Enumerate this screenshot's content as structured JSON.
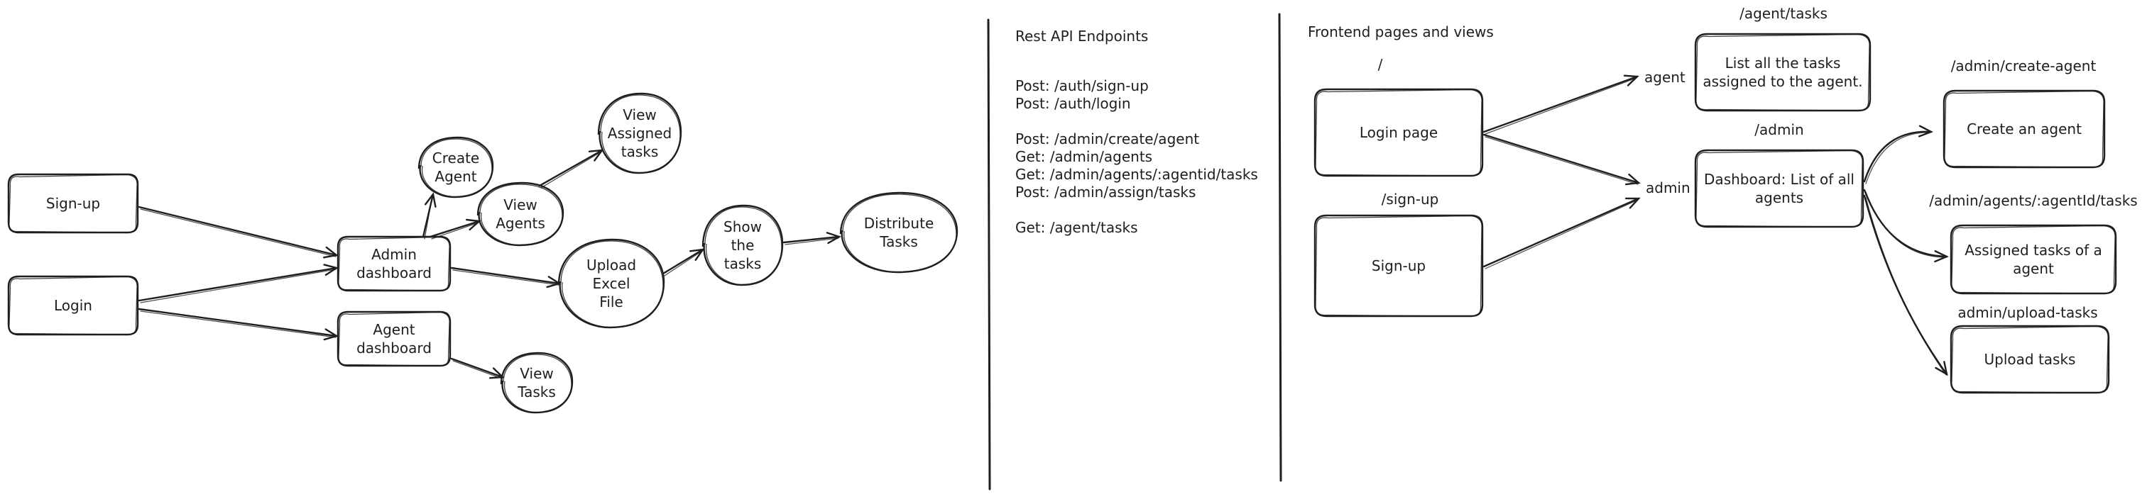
{
  "flow": {
    "nodes": [
      {
        "id": "sign_up",
        "lines": [
          "Sign-up"
        ]
      },
      {
        "id": "login",
        "lines": [
          "Login"
        ]
      },
      {
        "id": "admin_dashboard",
        "lines": [
          "Admin",
          "dashboard"
        ]
      },
      {
        "id": "agent_dashboard",
        "lines": [
          "Agent",
          "dashboard"
        ]
      },
      {
        "id": "create_agent",
        "lines": [
          "Create",
          "Agent"
        ]
      },
      {
        "id": "view_agents",
        "lines": [
          "View",
          "Agents"
        ]
      },
      {
        "id": "view_assigned_tasks",
        "lines": [
          "View",
          "Assigned",
          "tasks"
        ]
      },
      {
        "id": "upload_excel",
        "lines": [
          "Upload",
          "Excel",
          "File"
        ]
      },
      {
        "id": "show_tasks",
        "lines": [
          "Show",
          "the",
          "tasks"
        ]
      },
      {
        "id": "distribute_tasks",
        "lines": [
          "Distribute",
          "Tasks"
        ]
      },
      {
        "id": "view_tasks",
        "lines": [
          "View",
          "Tasks"
        ]
      }
    ],
    "edges": [
      [
        "sign_up",
        "admin_dashboard"
      ],
      [
        "login",
        "admin_dashboard"
      ],
      [
        "login",
        "agent_dashboard"
      ],
      [
        "admin_dashboard",
        "create_agent"
      ],
      [
        "admin_dashboard",
        "view_agents"
      ],
      [
        "view_agents",
        "view_assigned_tasks"
      ],
      [
        "admin_dashboard",
        "upload_excel"
      ],
      [
        "upload_excel",
        "show_tasks"
      ],
      [
        "show_tasks",
        "distribute_tasks"
      ],
      [
        "agent_dashboard",
        "view_tasks"
      ]
    ]
  },
  "api": {
    "title": "Rest API Endpoints",
    "lines": [
      "Post: /auth/sign-up",
      "Post: /auth/login",
      "",
      "Post: /admin/create/agent",
      "Get: /admin/agents",
      "Get: /admin/agents/:agentid/tasks",
      "Post: /admin/assign/tasks",
      "",
      "Get: /agent/tasks"
    ]
  },
  "frontend": {
    "title": "Frontend pages and views",
    "nodes": [
      {
        "id": "login_page",
        "route": "/",
        "lines": [
          "Login page"
        ]
      },
      {
        "id": "signup_page",
        "route": "/sign-up",
        "lines": [
          "Sign-up"
        ]
      },
      {
        "id": "agent_tasks",
        "route": "/agent/tasks",
        "lines": [
          "List all the tasks",
          "assigned to the agent."
        ]
      },
      {
        "id": "admin_dashboard_page",
        "route": "/admin",
        "lines": [
          "Dashboard: List of all",
          "agents"
        ]
      },
      {
        "id": "create_agent_page",
        "route": "/admin/create-agent",
        "lines": [
          "Create an agent"
        ]
      },
      {
        "id": "assigned_tasks_page",
        "route": "/admin/agents/:agentId/tasks",
        "lines": [
          "Assigned tasks of a",
          "agent"
        ]
      },
      {
        "id": "upload_tasks_page",
        "route": "admin/upload-tasks",
        "lines": [
          "Upload tasks"
        ]
      }
    ],
    "labels": {
      "agent": "agent",
      "admin": "admin"
    }
  }
}
